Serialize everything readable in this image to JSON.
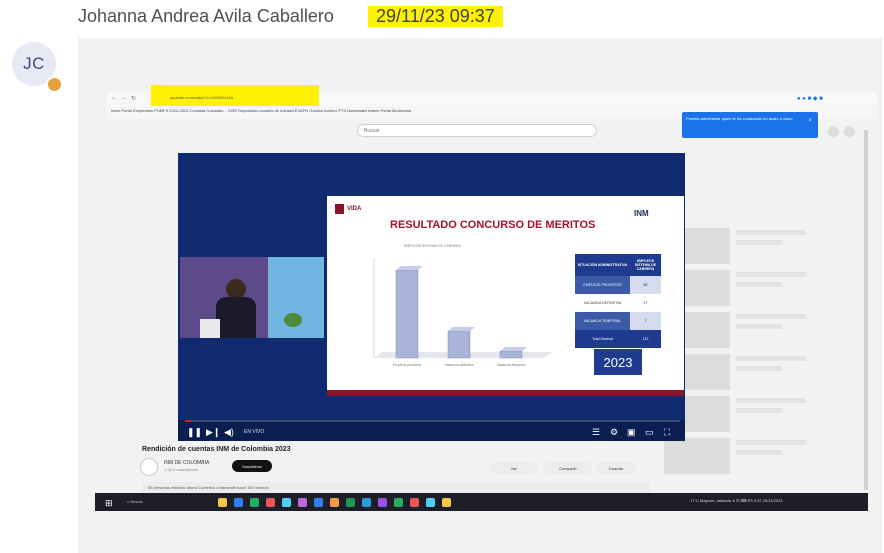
{
  "message": {
    "avatar_initials": "JC",
    "sender": "Johanna Andrea Avila Caballero",
    "timestamp": "29/11/23 09:37"
  },
  "browser": {
    "url": "youtube.com/watch?v=IJWIAV1c4A",
    "bookmarks": "Inicio  Portal Empleados  PNMFS 2022-2023  Consulta Cuidadan...  SISE  Repositorio  canales de entrada  ESAPN  Gestion  Archivo  PT3  Novedades  Admin Portal  Moderador",
    "search_placeholder": "Buscar",
    "notification": "Puedes administrar quien te ha contactado en audio o video",
    "notification_close": "×"
  },
  "video": {
    "title": "Rendición de cuentas INM de Colombia 2023",
    "channel": "INM DE COLOMBIA",
    "subscribers": "1.34 K suscriptores",
    "subscribe_label": "Suscribirse",
    "like_label": "Me",
    "share_label": "Compartir",
    "save_label": "Guardar",
    "description": "35 personas mirando ahora  Comenzó a transmitir hace 100 minutos",
    "time_label": "EN VIVO"
  },
  "slide": {
    "logo_text": "VIDA",
    "title": "RESULTADO CONCURSO DE MERITOS",
    "brand": "INM",
    "chart_caption": "EMPLEOS SISTEMA DE CARRERA",
    "year": "2023",
    "table": {
      "headers": [
        "SITUACIÓN ADMINISTRATIVA",
        "EMPLEOS SISTEMA DE CARRERA"
      ],
      "rows": [
        [
          "EMPLEOS PROVISTOS",
          "88"
        ],
        [
          "VACANCIA DEFINITIVA",
          "27"
        ],
        [
          "VACANCIA TEMPORAL",
          "7"
        ],
        [
          "Total General",
          "122"
        ]
      ]
    }
  },
  "chart_data": {
    "type": "bar",
    "categories": [
      "Empleos provistos",
      "Vacancia definitiva",
      "Vacancia temporal"
    ],
    "values": [
      88,
      27,
      7
    ],
    "title": "EMPLEOS SISTEMA DE CARRERA",
    "xlabel": "",
    "ylabel": "",
    "ylim": [
      0,
      100
    ]
  },
  "taskbar": {
    "start_icon": "windows-icon",
    "search_label": "Buscar",
    "tray_text": "17°C  Mayorm. nublado   ∧  ⊡  ⌨  ES  9:37  29/11/2023"
  },
  "colors": {
    "highlight": "#fff200",
    "player_bg": "#0f2a6e",
    "slide_title": "#a4122e",
    "bar": "#a9b4d8",
    "table_header": "#1f3b8f"
  }
}
